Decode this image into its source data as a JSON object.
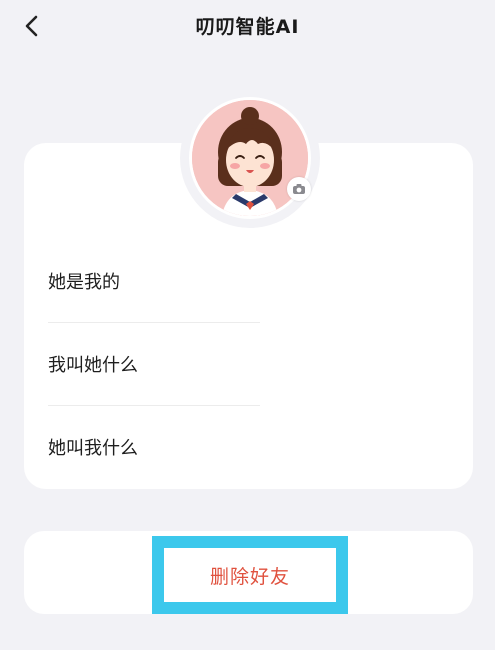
{
  "header": {
    "title": "叨叨智能AI",
    "back_icon": "chevron-left-icon"
  },
  "profile": {
    "avatar_icon": "girl-avatar-icon",
    "camera_icon": "camera-icon",
    "rows": [
      {
        "label": "她是我的"
      },
      {
        "label": "我叫她什么"
      },
      {
        "label": "她叫我什么"
      }
    ]
  },
  "actions": {
    "delete_label": "删除好友",
    "delete_color": "#e0523f",
    "highlight_color": "#3cc8ec"
  }
}
